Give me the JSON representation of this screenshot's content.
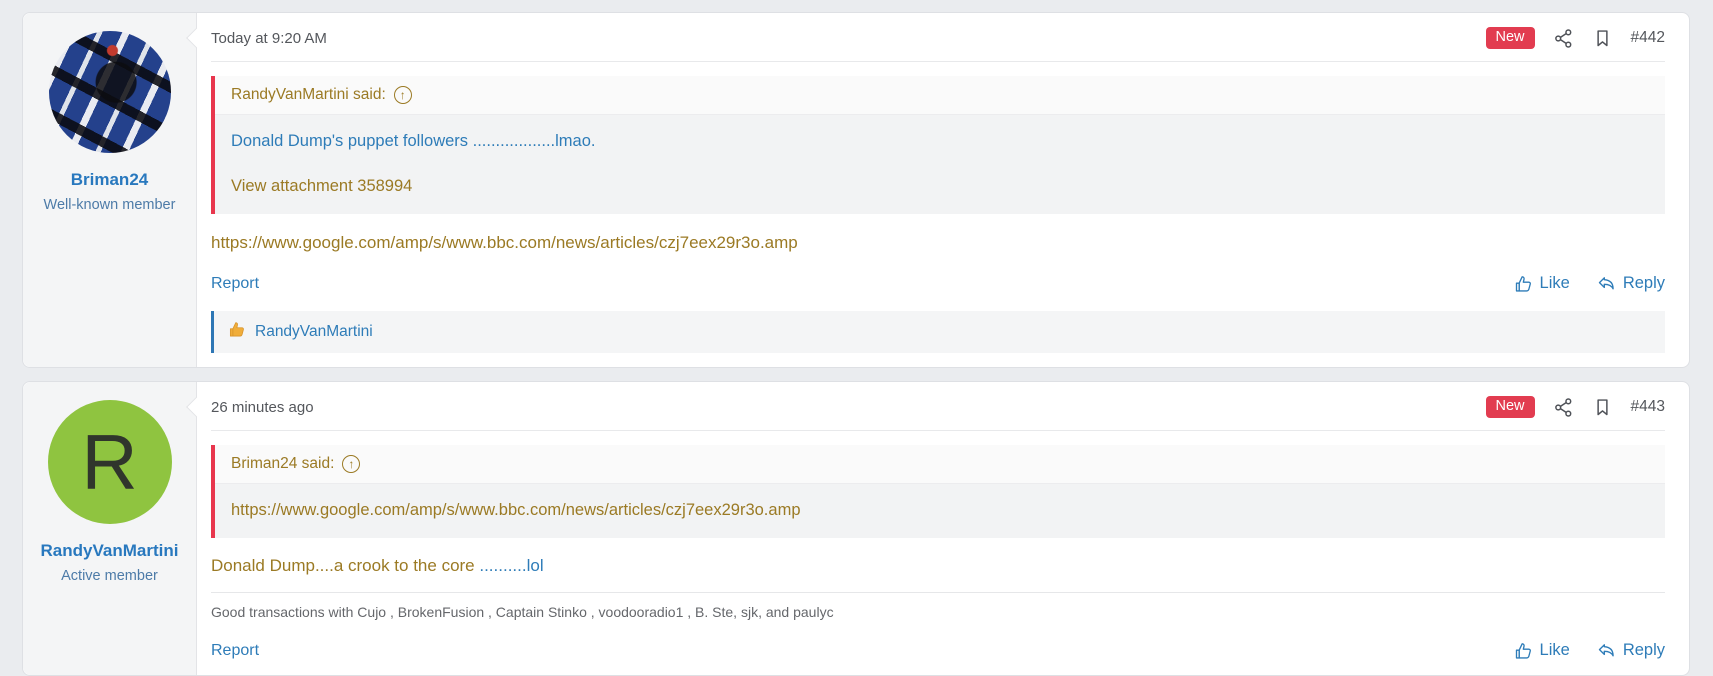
{
  "colors": {
    "accent_blue": "#2e7cb8",
    "link_gold": "#9b7a24",
    "badge_red": "#e23c50",
    "quote_border_red": "#e8364d",
    "username_blue": "#2878be",
    "avatar_green": "#8fc440"
  },
  "posts": [
    {
      "author": "Briman24",
      "user_title": "Well-known member",
      "avatar": {
        "type": "photo",
        "icon": "guitar-photo-avatar"
      },
      "timestamp": "Today at 9:20 AM",
      "badge_new": "New",
      "post_number": "#442",
      "icons": [
        "share-icon",
        "bookmark-icon"
      ],
      "quote": {
        "attribution": "RandyVanMartini said:",
        "expand_icon": "↑",
        "lines": [
          {
            "text": "Donald Dump's puppet followers ..................lmao."
          },
          {
            "text": "View attachment 358994"
          }
        ]
      },
      "body_link": "https://www.google.com/amp/s/www.bbc.com/news/articles/czj7eex29r3o.amp",
      "report_label": "Report",
      "like_label": "Like",
      "reply_label": "Reply",
      "reactions": {
        "icon": "thumbs-up-emoji",
        "users": "RandyVanMartini"
      }
    },
    {
      "author": "RandyVanMartini",
      "user_title": "Active member",
      "avatar": {
        "type": "letter",
        "letter": "R"
      },
      "timestamp": "26 minutes ago",
      "badge_new": "New",
      "post_number": "#443",
      "icons": [
        "share-icon",
        "bookmark-icon"
      ],
      "quote": {
        "attribution": "Briman24 said:",
        "expand_icon": "↑",
        "lines": [
          {
            "text": "https://www.google.com/amp/s/www.bbc.com/news/articles/czj7eex29r3o.amp"
          }
        ]
      },
      "body_text_gold": "Donald Dump....a crook to the core ",
      "body_text_blue": "..........lol",
      "signature": "Good transactions with Cujo , BrokenFusion , Captain Stinko , voodooradio1 , B. Ste, sjk, and paulyc",
      "report_label": "Report",
      "like_label": "Like",
      "reply_label": "Reply"
    }
  ]
}
